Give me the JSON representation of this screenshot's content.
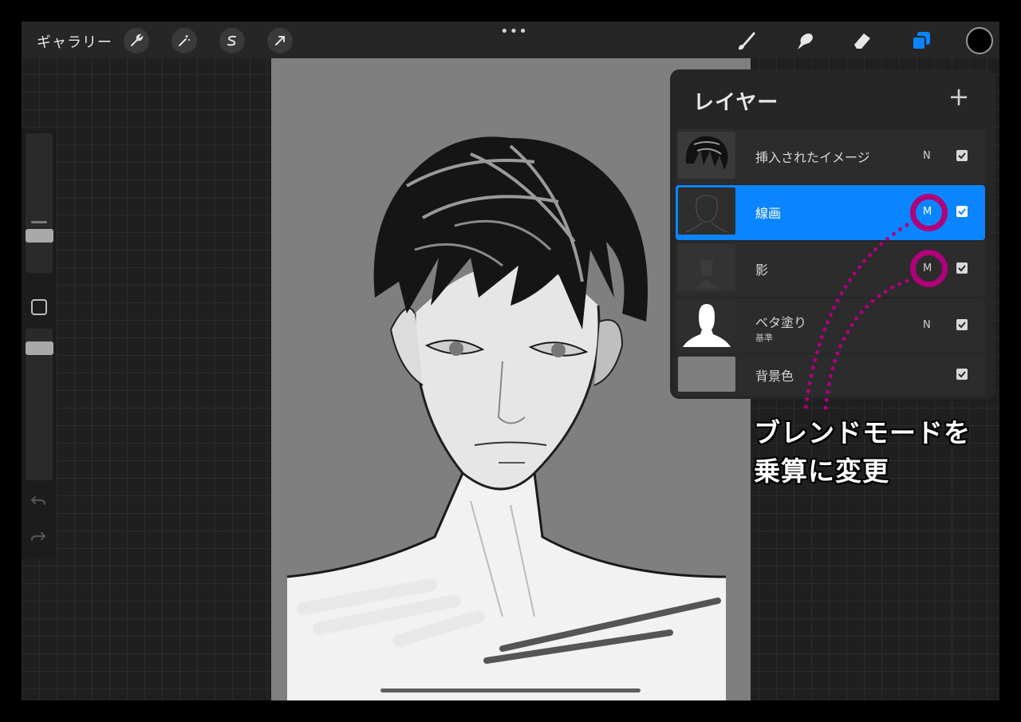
{
  "topbar": {
    "gallery_label": "ギャラリー",
    "more_label": "•••",
    "left_tools": [
      "wrench-icon",
      "magic-wand-icon",
      "selection-icon",
      "transform-arrow-icon"
    ],
    "right_tools": [
      "brush-icon",
      "smudge-icon",
      "eraser-icon",
      "layers-icon"
    ],
    "active_tool": "layers-icon",
    "accent_color": "#0a84ff",
    "current_color": "#000000"
  },
  "sidebar": {
    "brush_size": "slider",
    "opacity": "slider",
    "undo_icon": "undo-icon",
    "redo_icon": "redo-icon"
  },
  "layers": {
    "title": "レイヤー",
    "add_label": "+",
    "items": [
      {
        "name": "挿入されたイメージ",
        "sub": "",
        "blend": "N",
        "visible": true,
        "selected": false
      },
      {
        "name": "線画",
        "sub": "",
        "blend": "M",
        "visible": true,
        "selected": true
      },
      {
        "name": "影",
        "sub": "",
        "blend": "M",
        "visible": true,
        "selected": false
      },
      {
        "name": "ベタ塗り",
        "sub": "基準",
        "blend": "N",
        "visible": true,
        "selected": false
      },
      {
        "name": "背景色",
        "sub": "",
        "blend": "",
        "visible": true,
        "selected": false
      }
    ]
  },
  "annotation": {
    "line1": "ブレンドモードを",
    "line2": "乗算に変更",
    "highlight_color": "#b0007a"
  }
}
